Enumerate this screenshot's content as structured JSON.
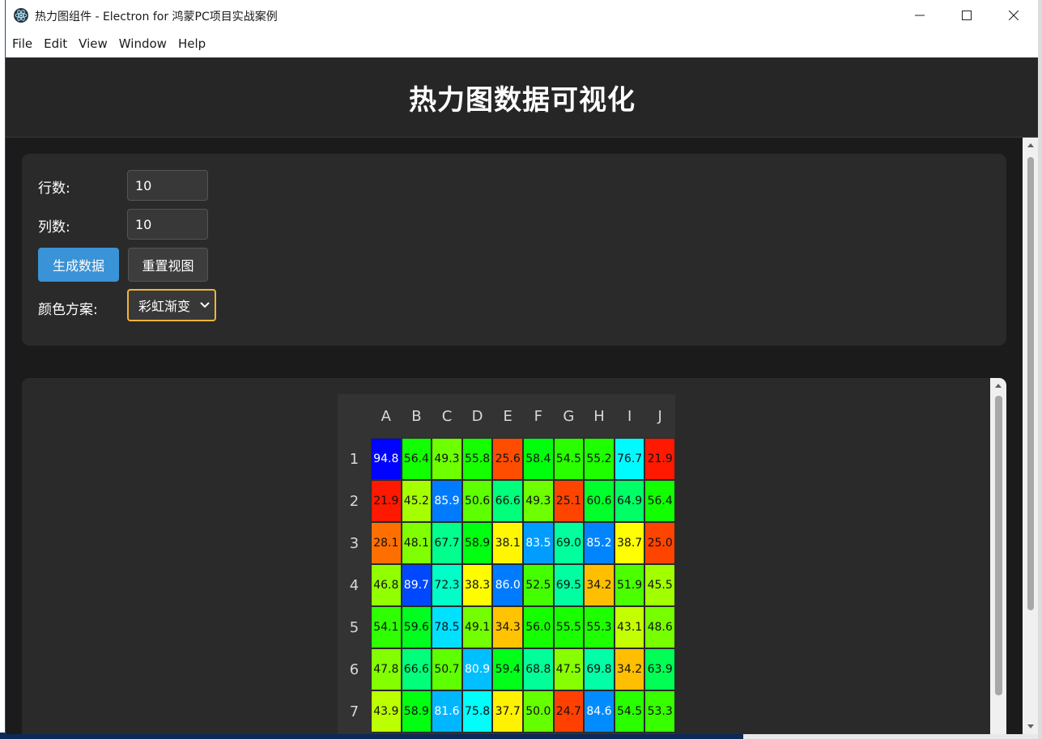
{
  "window": {
    "title": "热力图组件 - Electron for 鸿蒙PC项目实战案例",
    "controls": {
      "minimize": "minimize-icon",
      "maximize": "maximize-icon",
      "close": "close-icon"
    }
  },
  "menu": [
    "File",
    "Edit",
    "View",
    "Window",
    "Help"
  ],
  "header": {
    "title": "热力图数据可视化"
  },
  "controls": {
    "rows_label": "行数:",
    "rows_value": "10",
    "cols_label": "列数:",
    "cols_value": "10",
    "generate_label": "生成数据",
    "reset_label": "重置视图",
    "scheme_label": "颜色方案:",
    "scheme_value": "彩虹渐变"
  },
  "colors": {
    "primary": "#3a93d6",
    "focus": "#f0b43a",
    "panel": "#2a2a2a",
    "background": "#1b1b1b"
  },
  "chart_data": {
    "type": "heatmap",
    "columns": [
      "A",
      "B",
      "C",
      "D",
      "E",
      "F",
      "G",
      "H",
      "I",
      "J"
    ],
    "rows": [
      "1",
      "2",
      "3",
      "4",
      "5",
      "6",
      "7"
    ],
    "values": [
      [
        94.8,
        56.4,
        49.3,
        55.8,
        25.6,
        58.4,
        54.5,
        55.2,
        76.7,
        21.9
      ],
      [
        21.9,
        45.2,
        85.9,
        50.6,
        66.6,
        49.3,
        25.1,
        60.6,
        64.9,
        56.4
      ],
      [
        28.1,
        48.1,
        67.7,
        58.9,
        38.1,
        83.5,
        69.0,
        85.2,
        38.7,
        25.0
      ],
      [
        46.8,
        89.7,
        72.3,
        38.3,
        86.0,
        52.5,
        69.5,
        34.2,
        51.9,
        45.5
      ],
      [
        54.1,
        59.6,
        78.5,
        49.1,
        34.3,
        56.0,
        55.5,
        55.3,
        43.1,
        48.6
      ],
      [
        47.8,
        66.6,
        50.7,
        80.9,
        59.4,
        68.8,
        47.5,
        69.8,
        34.2,
        63.9
      ],
      [
        43.9,
        58.9,
        81.6,
        75.8,
        37.7,
        50.0,
        24.7,
        84.6,
        54.5,
        53.3
      ]
    ],
    "color_scheme": "rainbow",
    "value_range": [
      20,
      95
    ]
  }
}
